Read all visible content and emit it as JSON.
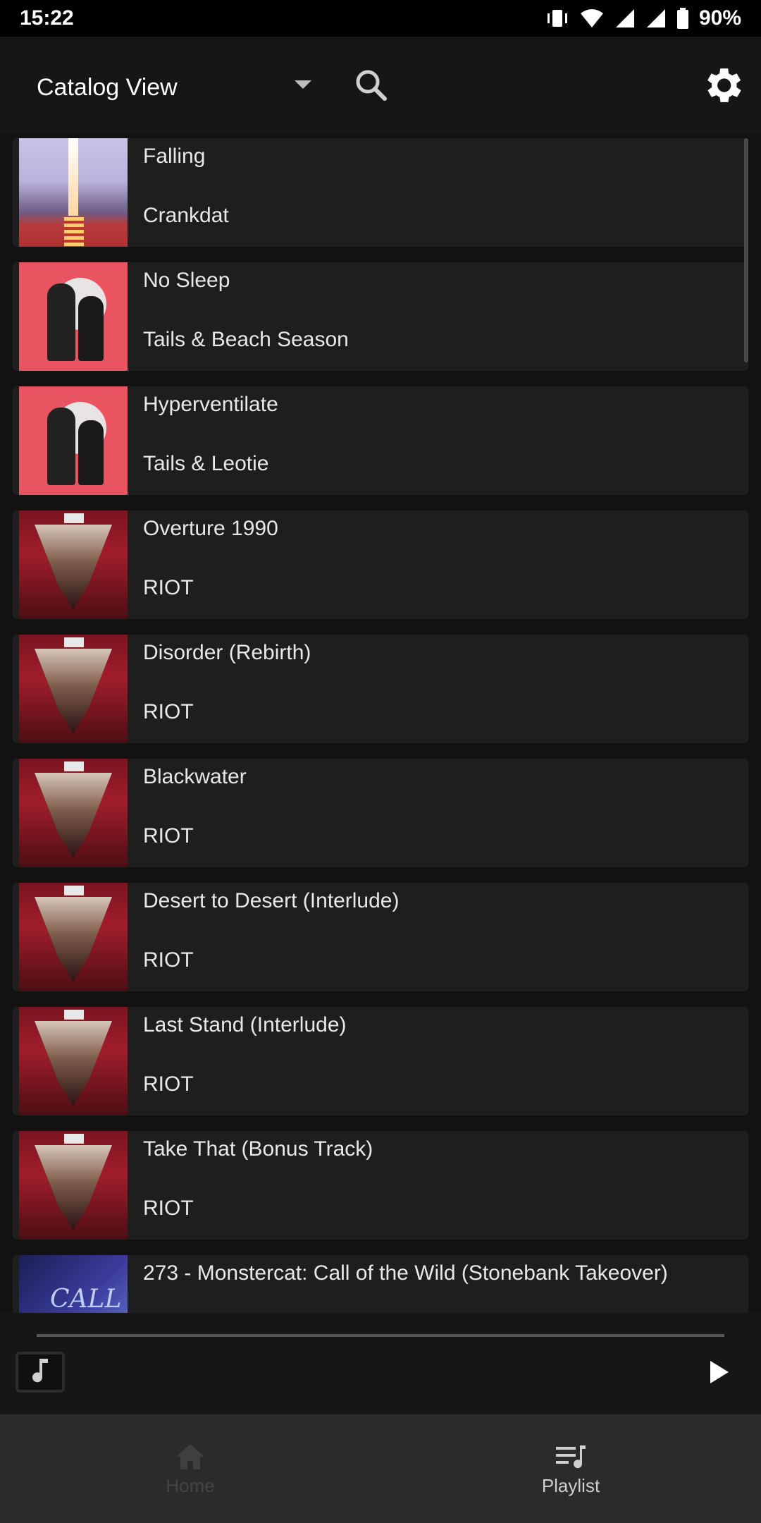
{
  "status_bar": {
    "time": "15:22",
    "battery": "90%"
  },
  "toolbar": {
    "view_label": "Catalog View"
  },
  "tracks": [
    {
      "title": "Falling",
      "artist": "Crankdat",
      "cover": "falling"
    },
    {
      "title": "No Sleep",
      "artist": "Tails & Beach Season",
      "cover": "pink"
    },
    {
      "title": "Hyperventilate",
      "artist": "Tails & Leotie",
      "cover": "pink"
    },
    {
      "title": "Overture 1990",
      "artist": "RIOT",
      "cover": "riot"
    },
    {
      "title": "Disorder (Rebirth)",
      "artist": "RIOT",
      "cover": "riot"
    },
    {
      "title": "Blackwater",
      "artist": "RIOT",
      "cover": "riot"
    },
    {
      "title": "Desert to Desert (Interlude)",
      "artist": "RIOT",
      "cover": "riot"
    },
    {
      "title": "Last Stand (Interlude)",
      "artist": "RIOT",
      "cover": "riot"
    },
    {
      "title": "Take That (Bonus Track)",
      "artist": "RIOT",
      "cover": "riot"
    },
    {
      "title": "273 - Monstercat: Call of the Wild (Stonebank Takeover)",
      "artist": "",
      "cover": "call"
    }
  ],
  "covers": {
    "call_text": "CALL"
  },
  "nav": {
    "home": "Home",
    "playlist": "Playlist"
  },
  "icons": {
    "search": "search-icon",
    "settings": "gear-icon",
    "play": "play-icon",
    "home": "home-icon",
    "playlist": "playlist-icon"
  }
}
